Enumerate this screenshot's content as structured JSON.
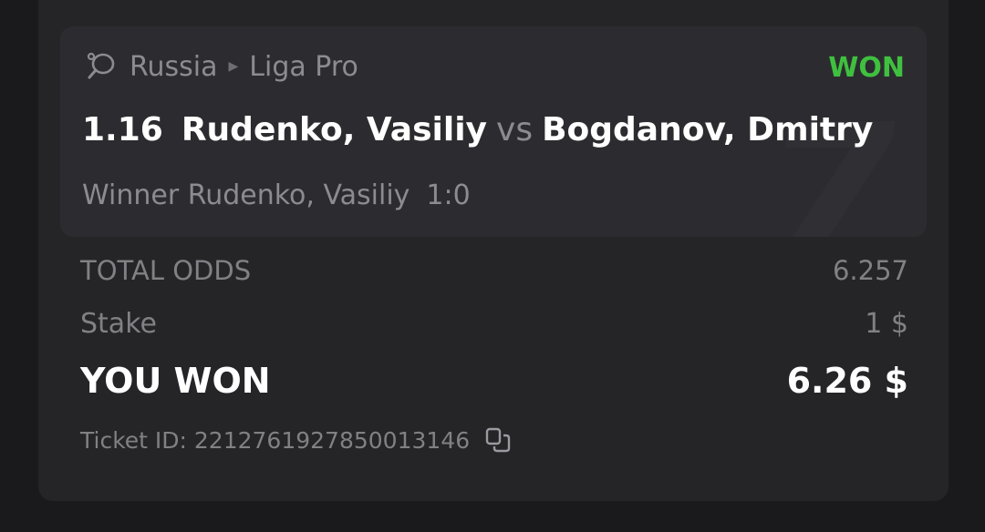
{
  "event": {
    "country": "Russia",
    "league": "Liga Pro",
    "status": "WON",
    "status_color": "#3fc03f",
    "odd": "1.16",
    "home": "Rudenko, Vasiliy",
    "vs": "vs",
    "away": "Bogdanov, Dmitry",
    "market": "Winner Rudenko, Vasiliy",
    "score": "1:0",
    "sport_icon": "table-tennis-icon"
  },
  "summary": {
    "total_odds_label": "TOTAL ODDS",
    "total_odds_value": "6.257",
    "stake_label": "Stake",
    "stake_value": "1 $",
    "won_label": "YOU WON",
    "won_value": "6.26 $"
  },
  "ticket": {
    "label": "Ticket ID: 2212761927850013146",
    "copy_icon": "copy-icon"
  }
}
